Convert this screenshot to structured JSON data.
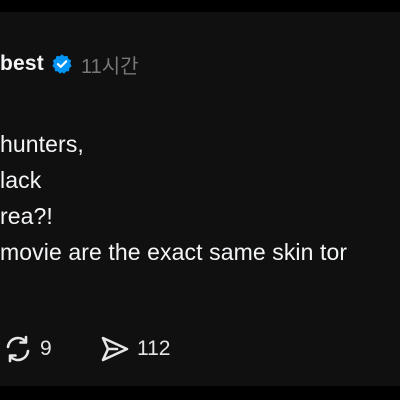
{
  "post": {
    "username": "best",
    "verified_icon": "verified-badge-icon",
    "timestamp": "11시간",
    "lines": [
      "hunters,",
      "lack",
      "rea?!",
      "movie are the exact same skin tor"
    ]
  },
  "actions": {
    "repost": {
      "icon": "repost-icon",
      "count": "9"
    },
    "share": {
      "icon": "share-icon",
      "count": "112"
    }
  },
  "colors": {
    "background": "#000000",
    "card": "#101010",
    "text": "#f3f5f7",
    "muted": "#777777",
    "verified": "#0095f6"
  }
}
